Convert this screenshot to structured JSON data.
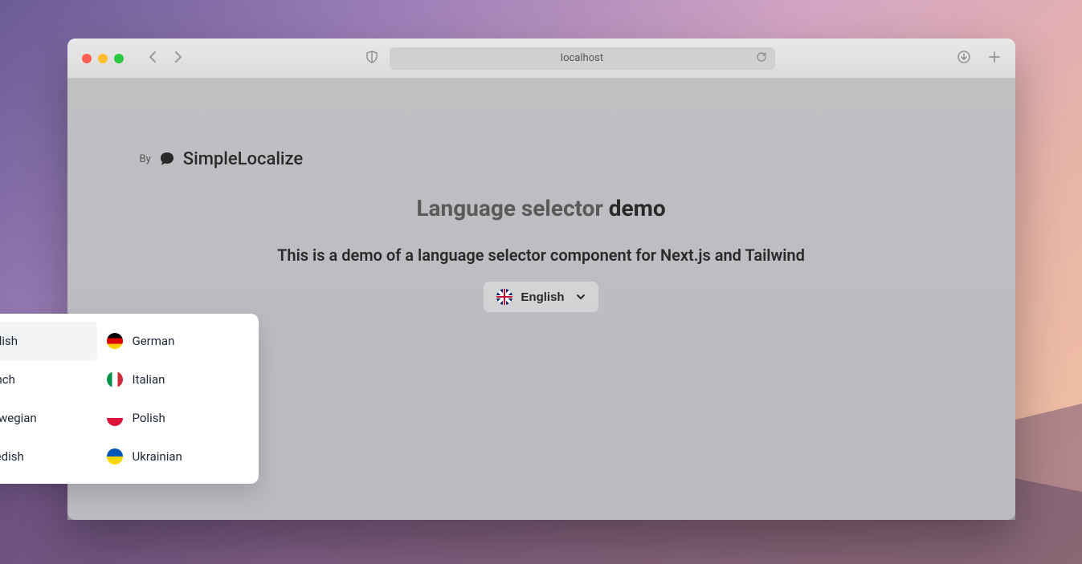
{
  "browser": {
    "address": "localhost"
  },
  "header": {
    "by_label": "By",
    "brand_name": "SimpleLocalize"
  },
  "page": {
    "title_prefix": "Language selector ",
    "title_emphasis": "demo",
    "subtitle": "This is a demo of a language selector component for Next.js and Tailwind"
  },
  "selector": {
    "current_label": "English",
    "current_flag": "gb",
    "options": [
      {
        "label": "English",
        "flag": "gb",
        "selected": true
      },
      {
        "label": "German",
        "flag": "de",
        "selected": false
      },
      {
        "label": "French",
        "flag": "fr",
        "selected": false
      },
      {
        "label": "Italian",
        "flag": "it",
        "selected": false
      },
      {
        "label": "Norwegian",
        "flag": "no",
        "selected": false
      },
      {
        "label": "Polish",
        "flag": "pl",
        "selected": false
      },
      {
        "label": "Swedish",
        "flag": "se",
        "selected": false
      },
      {
        "label": "Ukrainian",
        "flag": "ua",
        "selected": false
      }
    ]
  }
}
